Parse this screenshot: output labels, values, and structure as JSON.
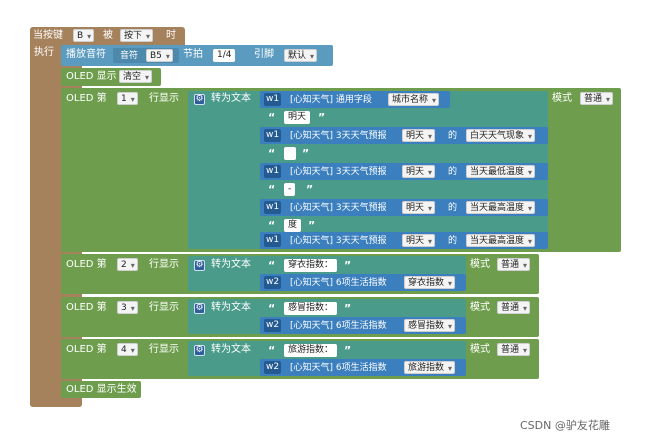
{
  "event": {
    "label_when": "当按键",
    "key": "B",
    "label_by": "被",
    "action": "按下",
    "label_time": "时",
    "label_do": "执行"
  },
  "tone": {
    "label": "播放音符",
    "label_note": "音符",
    "note": "B5",
    "label_beat": "节拍",
    "beat": "1/4",
    "label_pin": "引脚",
    "pin": "默认"
  },
  "oled_show": {
    "label": "OLED 显示",
    "value": "清空"
  },
  "rows": [
    {
      "label_oled": "OLED 第",
      "num": "1",
      "label_row": "行显示",
      "label_convert": "转为文本",
      "label_mode": "模式",
      "mode": "普通",
      "items": [
        {
          "kind": "api",
          "w": "w1",
          "text": "[心知天气] 通用字段",
          "a": "城市名称"
        },
        {
          "kind": "str",
          "text": "明天"
        },
        {
          "kind": "api3",
          "w": "w1",
          "text": "[心知天气] 3天天气预报",
          "a": "明天",
          "de": "的",
          "b": "白天天气现象"
        },
        {
          "kind": "str",
          "text": ""
        },
        {
          "kind": "api3",
          "w": "w1",
          "text": "[心知天气] 3天天气预报",
          "a": "明天",
          "de": "的",
          "b": "当天最低温度"
        },
        {
          "kind": "str",
          "text": "-"
        },
        {
          "kind": "api3",
          "w": "w1",
          "text": "[心知天气] 3天天气预报",
          "a": "明天",
          "de": "的",
          "b": "当天最高温度"
        },
        {
          "kind": "str",
          "text": "度"
        },
        {
          "kind": "api3",
          "w": "w1",
          "text": "[心知天气] 3天天气预报",
          "a": "明天",
          "de": "的",
          "b": "当天最高温度"
        }
      ]
    },
    {
      "label_oled": "OLED 第",
      "num": "2",
      "label_row": "行显示",
      "label_convert": "转为文本",
      "label_mode": "模式",
      "mode": "普通",
      "items": [
        {
          "kind": "str",
          "text": "穿衣指数："
        },
        {
          "kind": "api",
          "w": "w2",
          "text": "[心知天气] 6项生活指数",
          "a": "穿衣指数"
        }
      ]
    },
    {
      "label_oled": "OLED 第",
      "num": "3",
      "label_row": "行显示",
      "label_convert": "转为文本",
      "label_mode": "模式",
      "mode": "普通",
      "items": [
        {
          "kind": "str",
          "text": "感冒指数："
        },
        {
          "kind": "api",
          "w": "w2",
          "text": "[心知天气] 6项生活指数",
          "a": "感冒指数"
        }
      ]
    },
    {
      "label_oled": "OLED 第",
      "num": "4",
      "label_row": "行显示",
      "label_convert": "转为文本",
      "label_mode": "模式",
      "mode": "普通",
      "items": [
        {
          "kind": "str",
          "text": "旅游指数："
        },
        {
          "kind": "api",
          "w": "w2",
          "text": "[心知天气] 6项生活指数",
          "a": "旅游指数"
        }
      ]
    }
  ],
  "oled_effect": {
    "label": "OLED 显示生效"
  },
  "watermark": "CSDN @驴友花雕",
  "colors": {
    "event": "#a5815c",
    "tone": "#5b9bbf",
    "oled": "#6e9e4d",
    "text": "#4a9b8a",
    "api": "#3b7fbe"
  }
}
